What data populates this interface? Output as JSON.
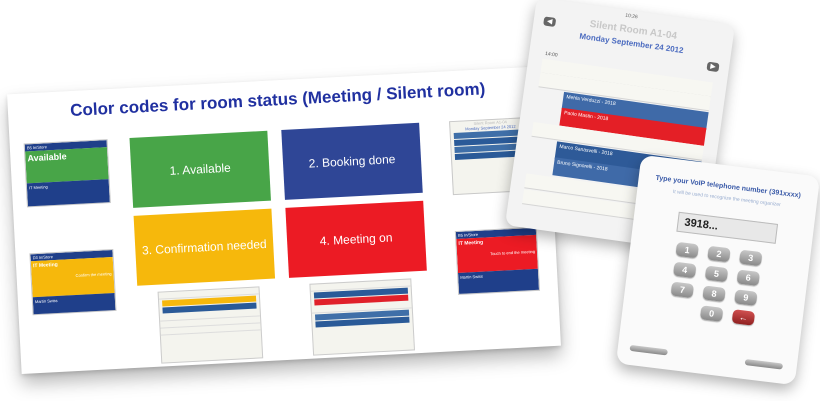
{
  "slide": {
    "title": "Color codes for room status (Meeting / Silent room)",
    "swatches": [
      {
        "label": "1. Available",
        "color": "#48a548"
      },
      {
        "label": "2. Booking done",
        "color": "#2f4696"
      },
      {
        "label": "3. Confirmation needed",
        "color": "#f6b80c"
      },
      {
        "label": "4. Meeting on",
        "color": "#ec1b24"
      }
    ],
    "mini_available": {
      "room": "B5 In/Store",
      "date": "Tuesday September 25 2012",
      "status": "Available",
      "next": "IT Meeting"
    },
    "mini_confirm": {
      "room": "D3 In/Store",
      "date": "Tuesday September 25 2012",
      "event": "IT Meeting",
      "action": "Confirm the meeting",
      "who": "Martin Swiss"
    },
    "mini_meeting": {
      "room": "B5 In/Store",
      "date": "Tuesday September 25 2012",
      "event": "IT Meeting",
      "action": "Touch to end the meeting",
      "who": "Martin Swiss"
    },
    "mini_silent": {
      "room": "Silent Room A1-04",
      "date": "Monday September 24 2012"
    }
  },
  "phone1": {
    "time": "10:26",
    "title": "Silent Room A1-04",
    "date": "Monday September 24 2012",
    "hour": "14:00",
    "events": [
      {
        "name": "Mehla Verduzzi - 2018",
        "color": "#3f6aa8"
      },
      {
        "name": "Paolo Mastin - 2018",
        "color": "#e41f26"
      },
      {
        "name": "Marco Sanasvelli - 2018",
        "color": "#2e5a98"
      },
      {
        "name": "Bruno Signorelli - 2018",
        "color": "#3f6aa8"
      }
    ]
  },
  "phone2": {
    "prompt": "Type your VoIP telephone number (391xxxx)",
    "subprompt": "It will be used to recognize the meeting organizer",
    "display": "3918...",
    "keys": [
      "1",
      "2",
      "3",
      "4",
      "5",
      "6",
      "7",
      "8",
      "9",
      "0",
      "←"
    ]
  }
}
